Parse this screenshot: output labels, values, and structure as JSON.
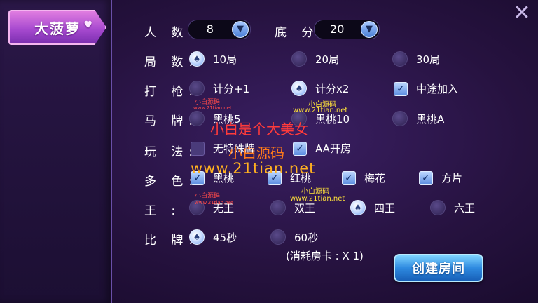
{
  "sidebar": {
    "tab_label": "大菠萝",
    "heart_icon": "♥"
  },
  "close": {
    "glyph": "✕"
  },
  "rows": {
    "players": {
      "label": "人 数:",
      "value": "8"
    },
    "base": {
      "label": "底 分:",
      "value": "20"
    },
    "rounds": {
      "label": "局 数:",
      "options": [
        "10局",
        "20局",
        "30局"
      ],
      "selected": 0
    },
    "shoot": {
      "label": "打 枪:",
      "options": [
        "计分+1",
        "计分x2"
      ],
      "selected": 1,
      "join_label": "中途加入",
      "join_checked": true
    },
    "horse": {
      "label": "马 牌:",
      "options": [
        "黑桃5",
        "黑桃10",
        "黑桃A"
      ],
      "selected": -1
    },
    "play": {
      "label": "玩 法:",
      "options": [
        "无特殊牌",
        "AA开房"
      ],
      "checked": [
        false,
        true
      ]
    },
    "colors": {
      "label": "多 色:",
      "options": [
        "黑桃",
        "红桃",
        "梅花",
        "方片"
      ],
      "checked": [
        true,
        true,
        true,
        true
      ]
    },
    "kings": {
      "label": "王  :",
      "options": [
        "无王",
        "双王",
        "四王",
        "六王"
      ],
      "selected": 2
    },
    "compare": {
      "label": "比 牌:",
      "options": [
        "45秒",
        "60秒"
      ],
      "selected": 0
    }
  },
  "cost_text": "(消耗房卡 : X 1)",
  "create_button": "创建房间",
  "watermarks": {
    "small_red": "小白源码",
    "small_red_url": "www.21tian.net",
    "small_yellow": "小白源码",
    "small_yellow_url": "www.21tian.net",
    "big_red": "小白是个大美女",
    "big_orange": "小白源码",
    "url": "www.21tian.net"
  },
  "colors": {
    "accent": "#a84ad0",
    "button": "#2e8ae0",
    "background": "#26123f"
  }
}
